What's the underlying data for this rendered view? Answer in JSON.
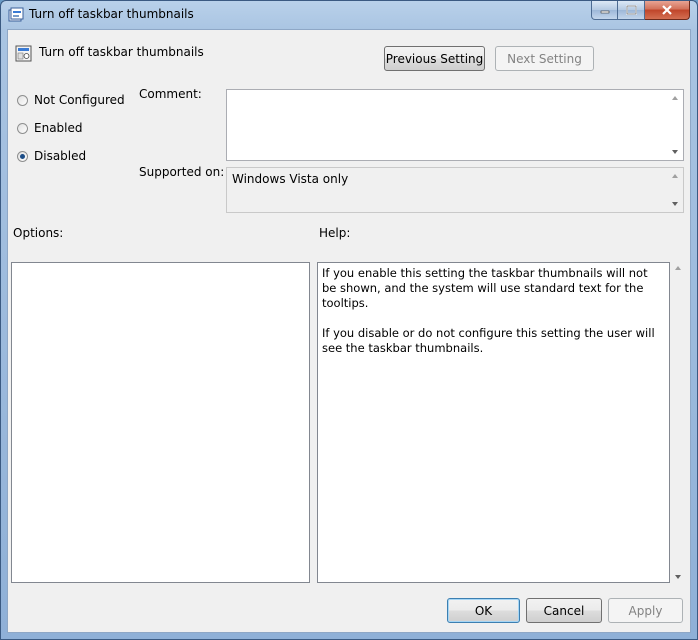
{
  "window": {
    "title": "Turn off taskbar thumbnails",
    "controls": [
      "minimize-icon",
      "maximize-icon",
      "close-icon"
    ]
  },
  "header": {
    "setting_name": "Turn off taskbar thumbnails",
    "previous_label": "Previous Setting",
    "next_label": "Next Setting"
  },
  "state": {
    "options": [
      {
        "label": "Not Configured",
        "selected": false
      },
      {
        "label": "Enabled",
        "selected": false
      },
      {
        "label": "Disabled",
        "selected": true
      }
    ]
  },
  "comment": {
    "label": "Comment:",
    "value": ""
  },
  "supported": {
    "label": "Supported on:",
    "value": "Windows Vista only"
  },
  "options_panel": {
    "label": "Options:"
  },
  "help_panel": {
    "label": "Help:",
    "paragraphs": [
      "If you enable this setting the taskbar thumbnails will not be shown, and the system will use standard text for the tooltips.",
      "If you disable or do not configure this setting the user will see the taskbar thumbnails."
    ]
  },
  "footer": {
    "ok_label": "OK",
    "cancel_label": "Cancel",
    "apply_label": "Apply"
  }
}
